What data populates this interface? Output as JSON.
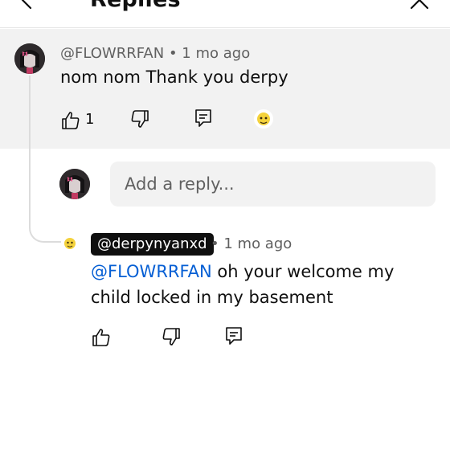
{
  "header": {
    "title": "Replies",
    "back_icon": "chevron-left-icon",
    "close_icon": "close-icon"
  },
  "parent_comment": {
    "author": "@FLOWRRFAN",
    "separator": "•",
    "time": "1 mo ago",
    "text": "nom nom Thank you derpy",
    "like_count": "1",
    "icons": [
      "thumb-up-icon",
      "thumb-down-icon",
      "reply-icon",
      "creator-heart-avatar-icon"
    ]
  },
  "reply_box": {
    "placeholder": "Add a reply..."
  },
  "reply": {
    "author": "@derpynyanxd",
    "separator": "•",
    "time": "1 mo ago",
    "mention": "@FLOWRRFAN",
    "text": " oh your welcome my child locked in my basement",
    "icons": [
      "thumb-up-icon",
      "thumb-down-icon",
      "reply-icon"
    ]
  },
  "colors": {
    "mention": "#065fd4",
    "panel_bg": "#f2f2f2",
    "author_chip_bg": "#0f0f0f",
    "meta_text": "#606060"
  }
}
